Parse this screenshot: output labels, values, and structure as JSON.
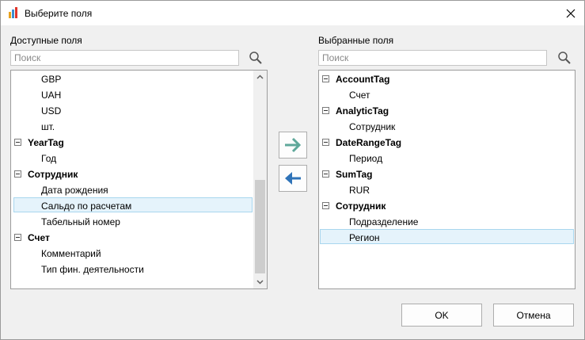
{
  "window": {
    "title": "Выберите поля"
  },
  "available": {
    "label": "Доступные поля",
    "search_placeholder": "Поиск",
    "rows": [
      {
        "text": "GBP",
        "kind": "child"
      },
      {
        "text": "UAH",
        "kind": "child"
      },
      {
        "text": "USD",
        "kind": "child"
      },
      {
        "text": "шт.",
        "kind": "child"
      },
      {
        "text": "YearTag",
        "kind": "group"
      },
      {
        "text": "Год",
        "kind": "child"
      },
      {
        "text": "Сотрудник",
        "kind": "group"
      },
      {
        "text": "Дата рождения",
        "kind": "child"
      },
      {
        "text": "Сальдо по расчетам",
        "kind": "child",
        "selected": true
      },
      {
        "text": "Табельный номер",
        "kind": "child"
      },
      {
        "text": "Счет",
        "kind": "group"
      },
      {
        "text": "Комментарий",
        "kind": "child"
      },
      {
        "text": "Тип фин. деятельности",
        "kind": "child"
      }
    ]
  },
  "selected": {
    "label": "Выбранные поля",
    "search_placeholder": "Поиск",
    "rows": [
      {
        "text": "AccountTag",
        "kind": "group"
      },
      {
        "text": "Счет",
        "kind": "child"
      },
      {
        "text": "AnalyticTag",
        "kind": "group"
      },
      {
        "text": "Сотрудник",
        "kind": "child"
      },
      {
        "text": "DateRangeTag",
        "kind": "group"
      },
      {
        "text": "Период",
        "kind": "child"
      },
      {
        "text": "SumTag",
        "kind": "group"
      },
      {
        "text": "RUR",
        "kind": "child"
      },
      {
        "text": "Сотрудник",
        "kind": "group"
      },
      {
        "text": "Подразделение",
        "kind": "child"
      },
      {
        "text": "Регион",
        "kind": "child",
        "selected": true
      }
    ]
  },
  "buttons": {
    "ok": "OK",
    "cancel": "Отмена"
  },
  "colors": {
    "add_arrow": "#5fa89a",
    "remove_arrow": "#2f73b8",
    "selection_fill": "#e5f3fb",
    "selection_border": "#a8d6ee"
  },
  "icons": {
    "app": "app-icon",
    "close": "close-icon",
    "search": "search-icon",
    "add": "arrow-right-icon",
    "remove": "arrow-left-icon",
    "expander": "collapse-icon"
  }
}
